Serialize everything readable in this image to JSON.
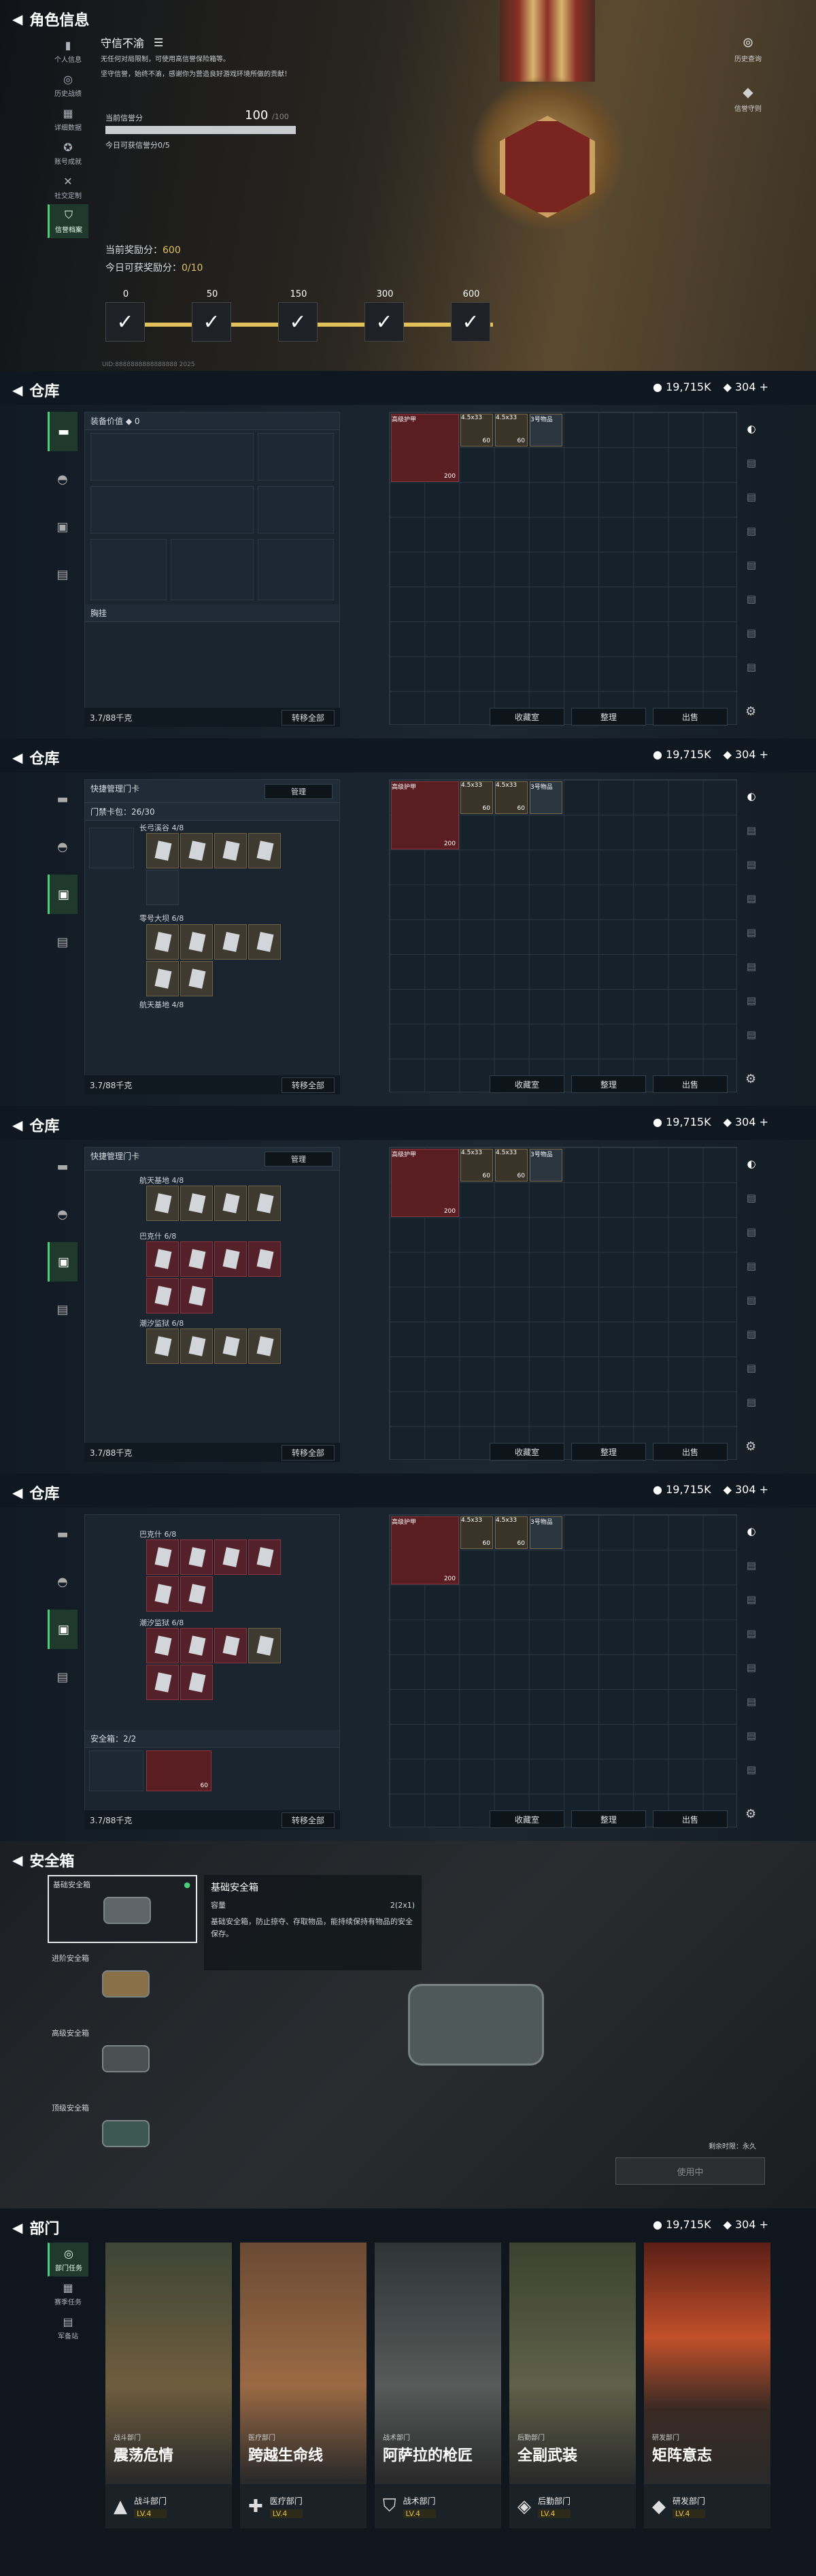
{
  "s1": {
    "title": "角色信息",
    "nav": [
      "个人信息",
      "历史战绩",
      "详细数据",
      "账号成就",
      "社交定制",
      "信誉档案"
    ],
    "heading": "守信不渝",
    "desc1": "无任何对局限制，可使用高信誉保险箱等。",
    "desc2": "坚守信誉，始终不渝，感谢你为营造良好游戏环境所做的贡献！",
    "score_label": "当前信誉分",
    "score": "100",
    "score_max": "/100",
    "today": "今日可获信誉分0/5",
    "reward1_label": "当前奖励分：",
    "reward1_val": "600",
    "reward2_label": "今日可获奖励分：",
    "reward2_val": "0/10",
    "milestones": [
      "0",
      "50",
      "150",
      "300",
      "600"
    ],
    "right": [
      "历史查询",
      "信誉守则"
    ],
    "uid": "UID:8888888888888888 2025"
  },
  "wh": {
    "title": "仓库",
    "money": "19,715K",
    "coupons": "304",
    "equip_value": "装备价值 ◆ 0",
    "body": "胸挂",
    "weight": "3.7/88千克",
    "transfer": "转移全部",
    "collect": "收藏室",
    "sort": "整理",
    "sell": "出售",
    "right_item_label": "高级护甲",
    "ammo1": "4.5x33",
    "ammo2": "4.5x33",
    "ammo3": "3号物品",
    "ammo_qty1": "60",
    "ammo_qty2": "60",
    "armor_dur": "200",
    "keycard_header": "快捷管理门卡",
    "manage": "管理",
    "keycard_count": "门禁卡包：26/30",
    "groups": [
      "长弓溪谷 4/8",
      "零号大坝 6/8",
      "巴克什 6/8",
      "航天基地 4/8",
      "潮汐监狱 6/8"
    ],
    "safe_label": "安全箱：2/2",
    "safe_qty": "60"
  },
  "s6": {
    "title": "安全箱",
    "items": [
      "基础安全箱",
      "进阶安全箱",
      "高级安全箱",
      "顶级安全箱"
    ],
    "info_title": "基础安全箱",
    "info_size_label": "容量",
    "info_size": "2(2x1)",
    "info_desc": "基础安全箱，防止掠夺、存取物品，能持续保持有物品的安全保存。",
    "footnote": "剩余时限：永久",
    "status_btn": "使用中"
  },
  "s7": {
    "title": "部门",
    "nav": [
      "部门任务",
      "赛季任务",
      "军备站"
    ],
    "money": "19,715K",
    "coupons": "304",
    "cards": [
      {
        "sub": "战斗部门",
        "name": "震荡危情",
        "foot": "战斗部门",
        "lv": "LV.4"
      },
      {
        "sub": "医疗部门",
        "name": "跨越生命线",
        "foot": "医疗部门",
        "lv": "LV.4"
      },
      {
        "sub": "战术部门",
        "name": "阿萨拉的枪匠",
        "foot": "战术部门",
        "lv": "LV.4"
      },
      {
        "sub": "后勤部门",
        "name": "全副武装",
        "foot": "后勤部门",
        "lv": "LV.4"
      },
      {
        "sub": "研发部门",
        "name": "矩阵意志",
        "foot": "研发部门",
        "lv": "LV.4"
      }
    ]
  },
  "colors": {
    "accent": "#49d17a",
    "gold": "#e2c15a"
  }
}
